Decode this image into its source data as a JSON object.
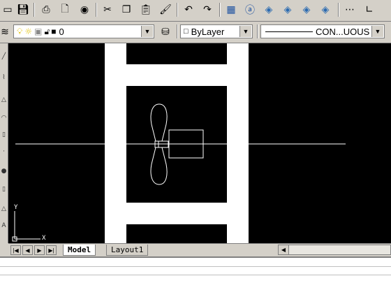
{
  "toolbar": {
    "icons": [
      "new-file",
      "save",
      "print",
      "print-preview",
      "spell-check",
      "cut",
      "copy",
      "paste",
      "match-properties",
      "undo",
      "redo",
      "design-center",
      "properties",
      "tool-palette",
      "db-connect",
      "markup",
      "distance",
      "ucs"
    ]
  },
  "layers": {
    "current_layer": "0",
    "color": "ByLayer",
    "linetype": "CON...UOUS"
  },
  "ucs": {
    "y_label": "Y",
    "x_label": "X"
  },
  "tabs": {
    "model": "Model",
    "layout1": "Layout1"
  }
}
